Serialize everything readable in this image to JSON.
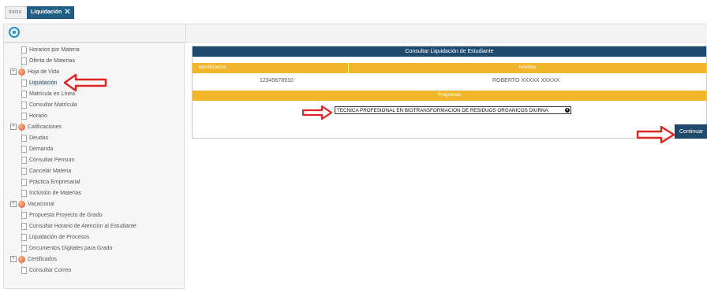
{
  "tabs": [
    {
      "label": "Inicio"
    },
    {
      "label": "Liquidación",
      "close": "✕"
    }
  ],
  "toolbar": {
    "refresh_icon": "refresh-icon"
  },
  "sidebar": {
    "items": [
      {
        "label": "Horarios por Materia",
        "type": "doc"
      },
      {
        "label": "Oferta de Materias",
        "type": "doc"
      },
      {
        "label": "Hoja de Vida",
        "type": "folder"
      },
      {
        "label": "Liquidación",
        "type": "doc"
      },
      {
        "label": "Matrícula en Línea",
        "type": "doc"
      },
      {
        "label": "Consultar Matrícula",
        "type": "doc"
      },
      {
        "label": "Horario",
        "type": "doc"
      },
      {
        "label": "Calificaciones",
        "type": "folder"
      },
      {
        "label": "Deudas",
        "type": "doc"
      },
      {
        "label": "Demanda",
        "type": "doc"
      },
      {
        "label": "Consultar Pensum",
        "type": "doc"
      },
      {
        "label": "Cancelar Materia",
        "type": "doc"
      },
      {
        "label": "Práctica Empresarial",
        "type": "doc"
      },
      {
        "label": "Inclusión de Materias",
        "type": "doc"
      },
      {
        "label": "Vacacional",
        "type": "folder"
      },
      {
        "label": "Propuesta Proyecto de Grado",
        "type": "doc"
      },
      {
        "label": "Consultar Horario de Atención al Estudiante",
        "type": "doc"
      },
      {
        "label": "Liquidación de Procesos",
        "type": "doc"
      },
      {
        "label": "Documentos Digitales para Grado",
        "type": "doc"
      },
      {
        "label": "Certificados",
        "type": "folder"
      },
      {
        "label": "Consultar Correo",
        "type": "doc"
      }
    ]
  },
  "panel": {
    "title": "Consultar Liquidación de Estudiante",
    "col_id": "Identificación",
    "col_name": "Nombre",
    "id_value": "12345678910",
    "name_value": "ROBERTO  XXXXX XXXXX",
    "programs_label": "Programas",
    "program_selected": "TECNICA PROFESIONAL EN BIOTRANSFORMACION DE RESIDUOS ORGANICOS DIURNA",
    "continue_label": "Continuar"
  },
  "colors": {
    "header": "#1f4a6e",
    "accent": "#f2b62b",
    "arrow": "#e02424",
    "tab_active": "#1f5f86"
  }
}
